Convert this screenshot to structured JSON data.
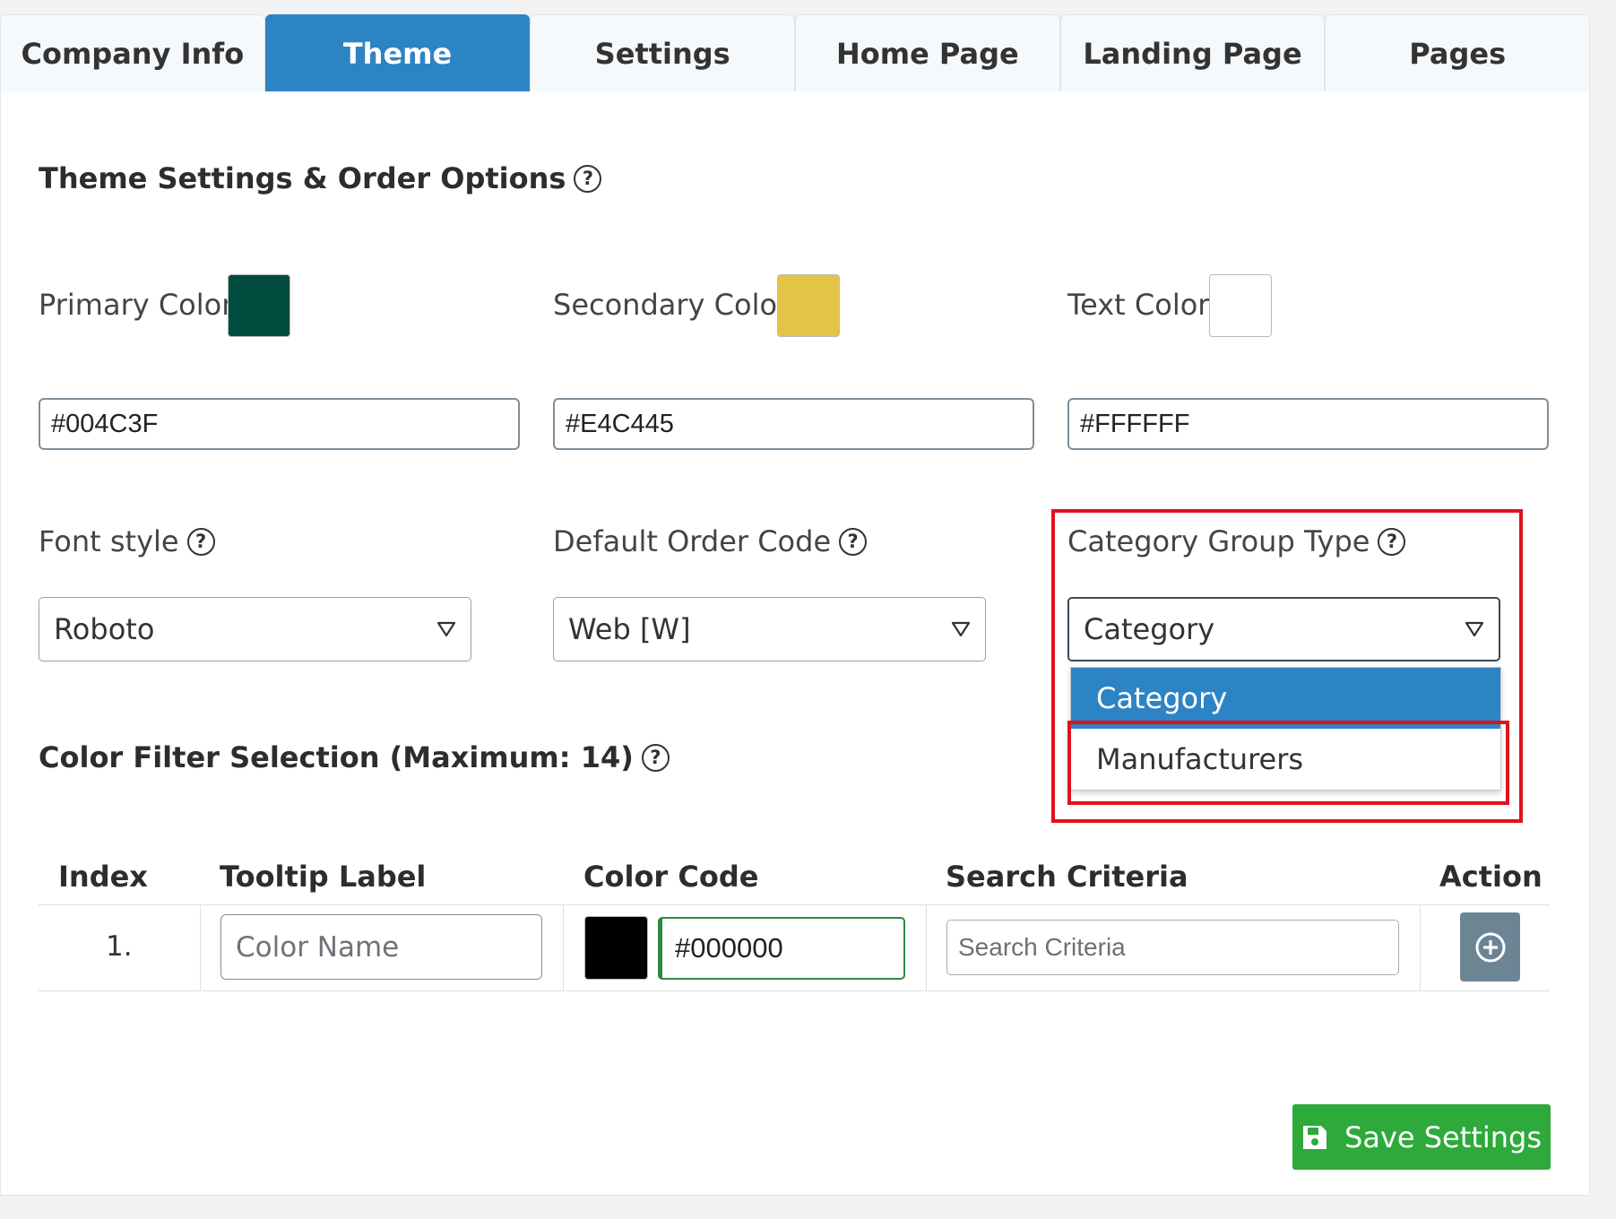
{
  "tabs": [
    {
      "label": "Company Info"
    },
    {
      "label": "Theme"
    },
    {
      "label": "Settings"
    },
    {
      "label": "Home Page"
    },
    {
      "label": "Landing Page"
    },
    {
      "label": "Pages"
    }
  ],
  "active_tab": "Theme",
  "section_title": "Theme Settings & Order Options",
  "help_glyph": "?",
  "colors": {
    "primary": {
      "label": "Primary Color",
      "value": "#004C3F"
    },
    "secondary": {
      "label": "Secondary Color",
      "value": "#E4C445"
    },
    "text": {
      "label": "Text Color",
      "value": "#FFFFFF"
    }
  },
  "font_style": {
    "label": "Font style",
    "selected": "Roboto"
  },
  "order_code": {
    "label": "Default Order Code",
    "selected": "Web [W]"
  },
  "category_group": {
    "label": "Category Group Type",
    "selected": "Category",
    "options": [
      "Category",
      "Manufacturers"
    ]
  },
  "color_filter": {
    "title": "Color Filter Selection (Maximum: 14)",
    "columns": [
      "Index",
      "Tooltip Label",
      "Color Code",
      "Search Criteria",
      "Action"
    ],
    "rows": [
      {
        "index": "1.",
        "tooltip_placeholder": "Color Name",
        "swatch_color": "#000000",
        "color_code": "#000000",
        "search_placeholder": "Search Criteria"
      }
    ]
  },
  "save_button": {
    "label": "Save Settings"
  },
  "icons": {
    "help": "question-circle-icon",
    "dropdown": "caret-down-icon",
    "add": "plus-circle-icon",
    "save": "floppy-disk-icon"
  },
  "theme": {
    "accent": "#2d84c4",
    "success": "#2ea93b",
    "highlight": "#e0121e"
  }
}
